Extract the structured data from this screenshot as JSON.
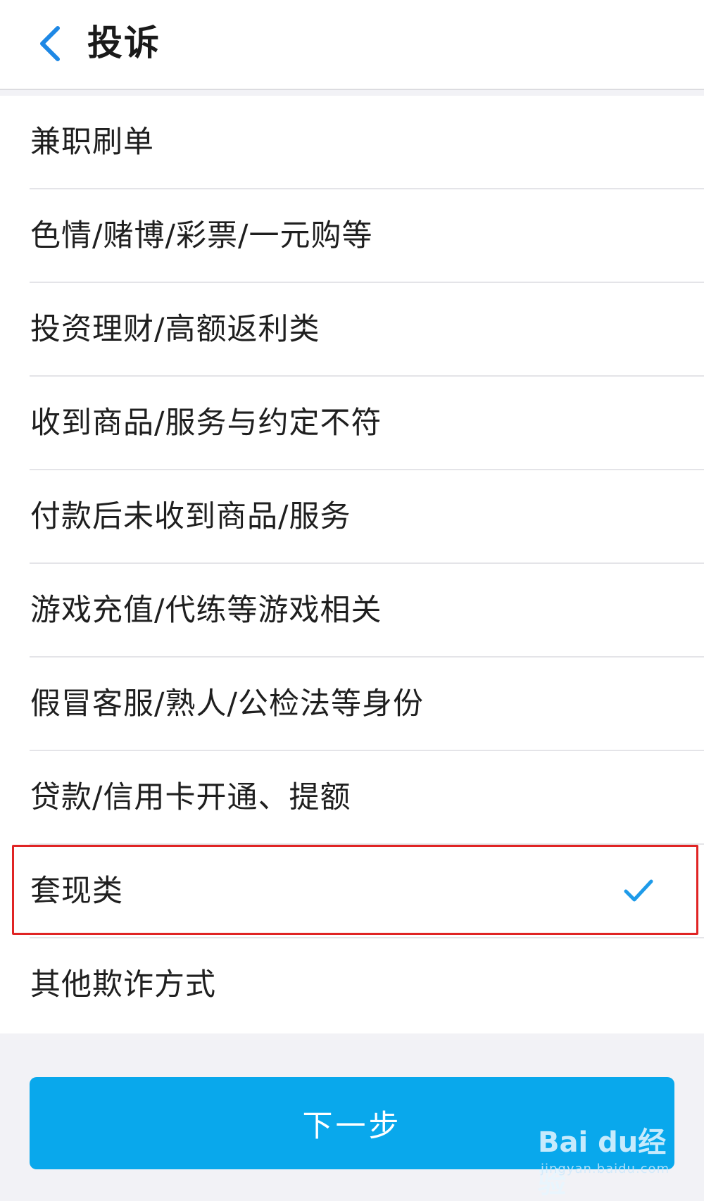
{
  "header": {
    "title": "投诉"
  },
  "list": {
    "items": [
      {
        "label": "兼职刷单"
      },
      {
        "label": "色情/赌博/彩票/一元购等"
      },
      {
        "label": "投资理财/高额返利类"
      },
      {
        "label": "收到商品/服务与约定不符"
      },
      {
        "label": "付款后未收到商品/服务"
      },
      {
        "label": "游戏充值/代练等游戏相关"
      },
      {
        "label": "假冒客服/熟人/公检法等身份"
      },
      {
        "label": "贷款/信用卡开通、提额"
      },
      {
        "label": "套现类",
        "selected": true
      },
      {
        "label": "其他欺诈方式"
      }
    ]
  },
  "footer": {
    "next_label": "下一步"
  },
  "watermark": {
    "logo_text": "Bai du经验",
    "url_text": "jingyan.baidu.com"
  },
  "colors": {
    "accent": "#09a8ec",
    "back_icon": "#1e88e5",
    "check_icon": "#1e9be9",
    "highlight": "#e02424"
  },
  "icons": {
    "back": "chevron-left-icon",
    "selected": "check-icon"
  }
}
